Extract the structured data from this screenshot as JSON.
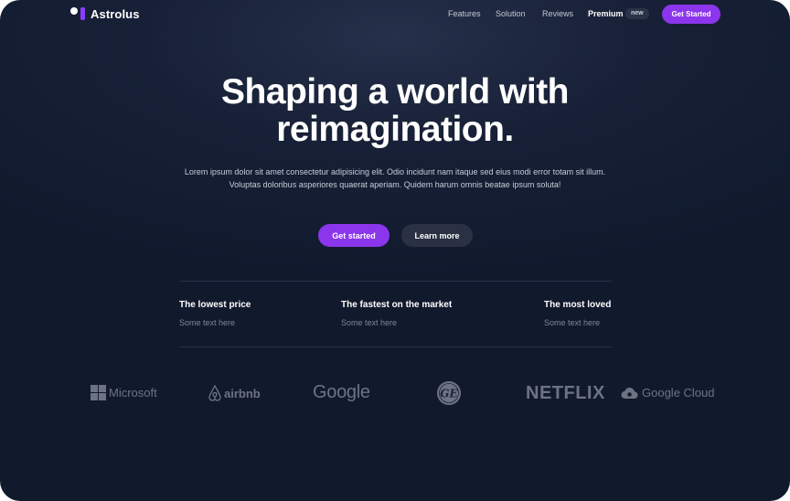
{
  "nav": {
    "brand": "Astrolus",
    "links": [
      "Features",
      "Solution",
      "Reviews"
    ],
    "premium_label": "Premium",
    "premium_badge": "new",
    "cta": "Get Started"
  },
  "hero": {
    "title_line1": "Shaping a world with",
    "title_line2": "reimagination.",
    "subtitle": "Lorem ipsum dolor sit amet consectetur adipisicing elit. Odio incidunt nam itaque sed eius modi error totam sit illum. Voluptas doloribus asperiores quaerat aperiam. Quidem harum omnis beatae ipsum soluta!",
    "primary_button": "Get started",
    "secondary_button": "Learn more"
  },
  "features": [
    {
      "title": "The lowest price",
      "text": "Some text here"
    },
    {
      "title": "The fastest on the market",
      "text": "Some text here"
    },
    {
      "title": "The most loved",
      "text": "Some text here"
    }
  ],
  "logos": {
    "microsoft": "Microsoft",
    "airbnb": "airbnb",
    "google": "Google",
    "netflix": "NETFLIX",
    "google_cloud": "Google Cloud"
  },
  "colors": {
    "accent": "#8b35ec",
    "background": "#111a2d"
  }
}
